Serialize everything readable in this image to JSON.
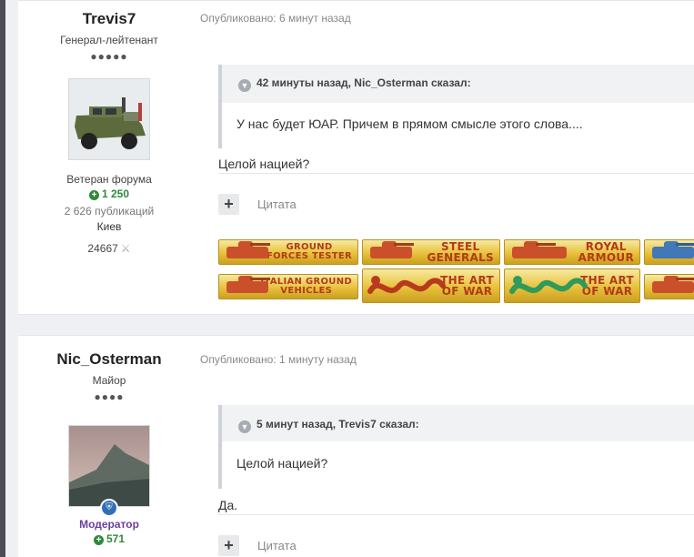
{
  "colors": {
    "moderator": "#6a3fa0",
    "reputation": "#2f8a3a",
    "badge_gold": "#e8c13b"
  },
  "posts": [
    {
      "author": "Trevis7",
      "rank": "Генерал-лейтенант",
      "pips": "●●●●●",
      "group": "Ветеран форума",
      "reputation": "1 250",
      "posts_count": "2 626 публикаций",
      "location": "Киев",
      "points": "24667",
      "published": "Опубликовано: 6 минут назад",
      "quote_header": "42 минуты назад, Nic_Osterman сказал:",
      "quote_text": "У нас будет ЮАР. Причем в прямом смысле этого слова....",
      "reply_text": "Целой нацией?",
      "cite_label": "Цитата",
      "badges": [
        {
          "text": "GROUND\nFORCES TESTER",
          "icon": "tank-icon"
        },
        {
          "text": "STEEL\nGENERALS",
          "icon": "tank-icon"
        },
        {
          "text": "ROYAL\nARMOUR",
          "icon": "tank-icon"
        },
        {
          "text": "",
          "icon": "tank-icon"
        },
        {
          "text": "ITALIAN GROUND\nVEHICLES",
          "icon": "tank-icon"
        },
        {
          "text": "THE ART\nOF WAR",
          "icon": "dragon-icon"
        },
        {
          "text": "THE ART\nOF WAR",
          "icon": "dragon-icon"
        },
        {
          "text": "",
          "icon": "tank-icon"
        }
      ]
    },
    {
      "author": "Nic_Osterman",
      "rank": "Майор",
      "pips": "●●●●",
      "group": "Модератор",
      "reputation": "571",
      "published": "Опубликовано: 1 минуту назад",
      "quote_header": "5 минут назад, Trevis7 сказал:",
      "quote_text": "Целой нацией?",
      "reply_text": "Да.",
      "cite_label": "Цитата"
    }
  ]
}
